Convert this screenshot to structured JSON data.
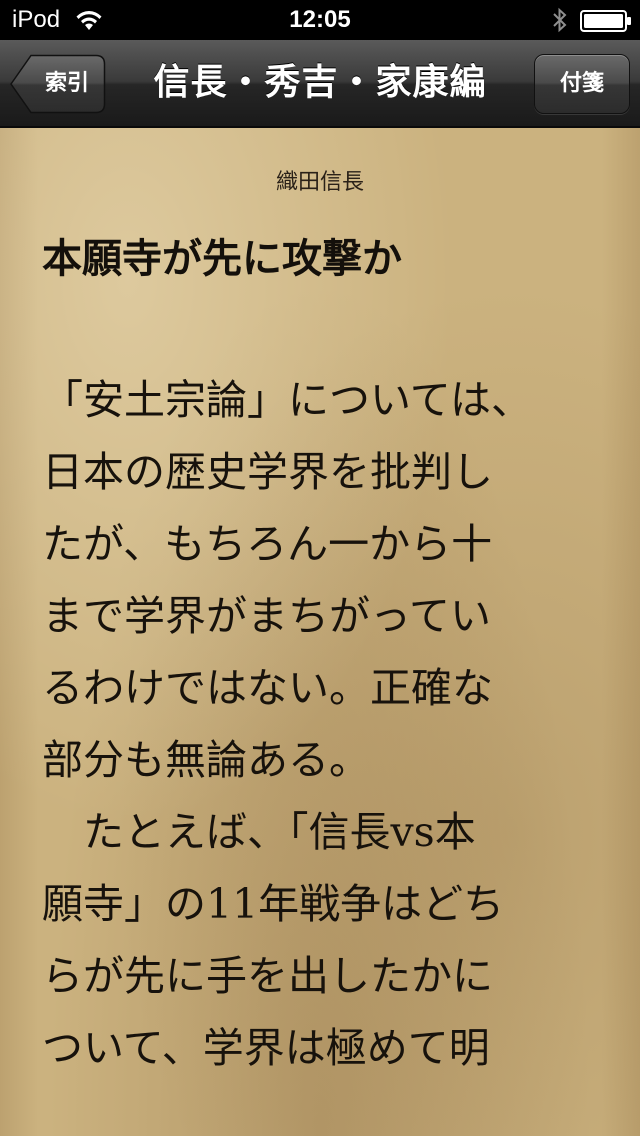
{
  "status_bar": {
    "carrier": "iPod",
    "time": "12:05"
  },
  "nav_bar": {
    "back_label": "索引",
    "title": "信長・秀吉・家康編",
    "bookmark_label": "付箋"
  },
  "page": {
    "header": "織田信長",
    "chapter_title": "本願寺が先に攻撃か",
    "body_lines": [
      "「安土宗論」については、",
      "日本の歴史学界を批判し",
      "たが、もちろん一から十",
      "まで学界がまちがってい",
      "るわけではない。正確な",
      "部分も無論ある。",
      "　たとえば、「信長vs本",
      "願寺」の11年戦争はどち",
      "らが先に手を出したかに",
      "ついて、学界は極めて明"
    ]
  },
  "colors": {
    "paper": "#cbb27f",
    "text": "#17120c",
    "nav_bar": "#2c2c2c"
  }
}
